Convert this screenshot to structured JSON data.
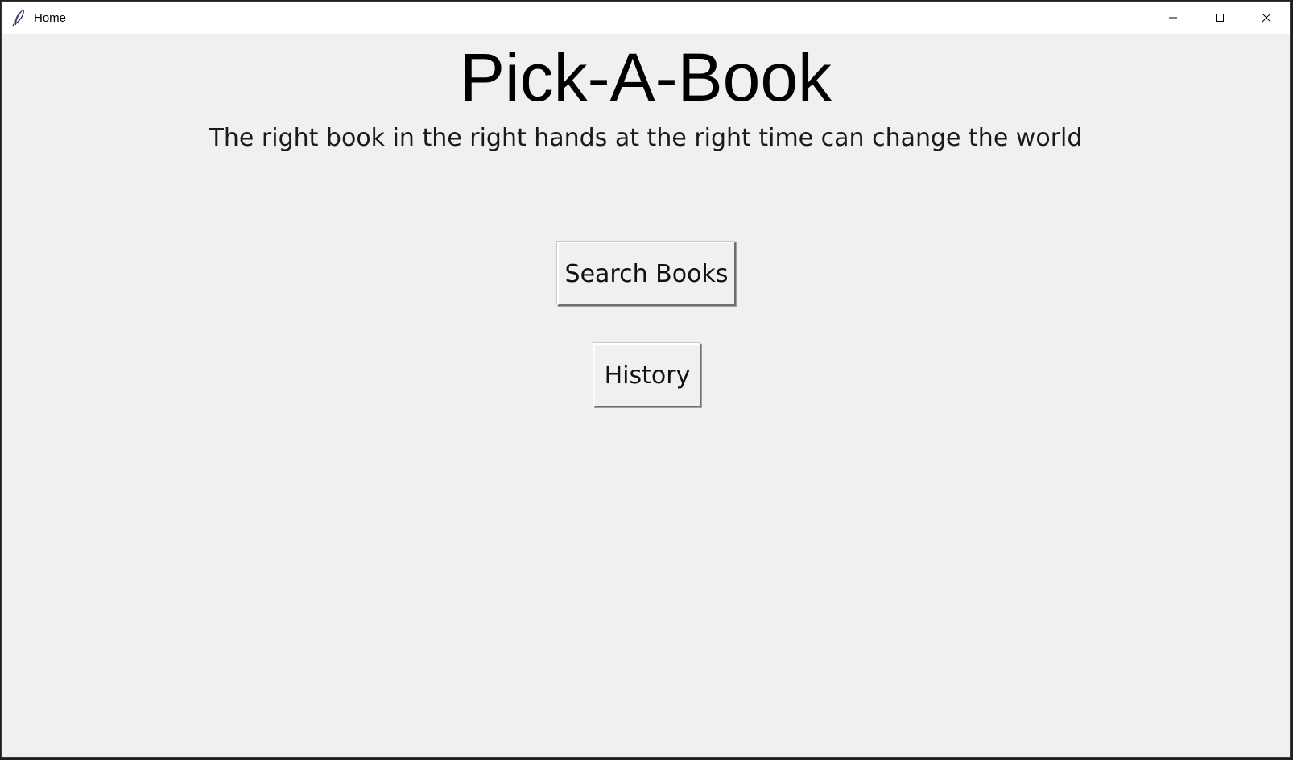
{
  "window": {
    "title": "Home",
    "app_icon": "feather-icon",
    "controls": {
      "minimize_icon": "minimize-icon",
      "maximize_icon": "maximize-icon",
      "close_icon": "close-icon"
    }
  },
  "main": {
    "heading": "Pick-A-Book",
    "tagline": "The right book in the right hands at the right time can change the world",
    "buttons": {
      "search_books": "Search Books",
      "history": "History"
    }
  },
  "colors": {
    "background": "#f0f0f0",
    "titlebar": "#ffffff",
    "text": "#000000"
  }
}
